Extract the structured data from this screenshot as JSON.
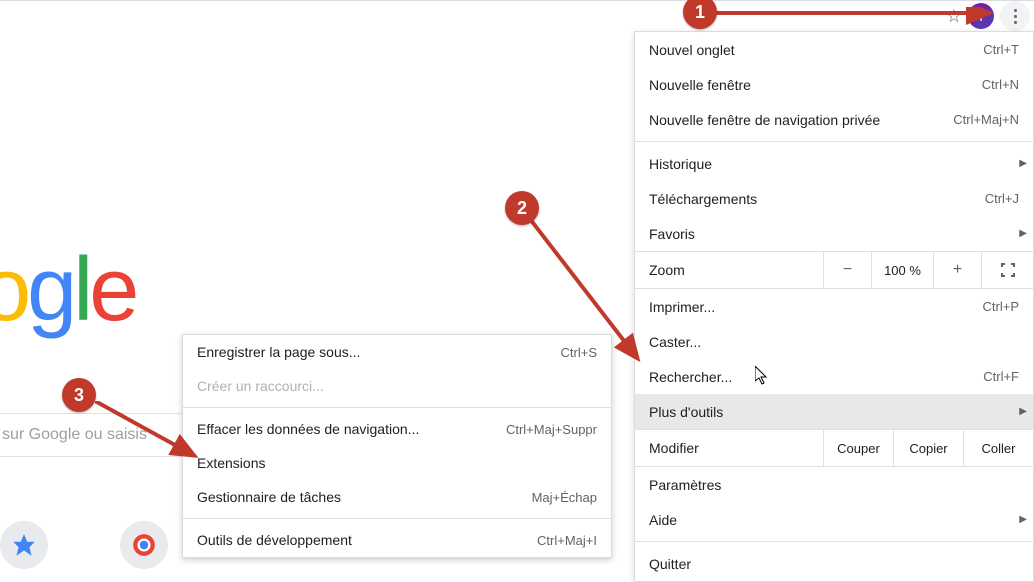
{
  "topbar": {
    "avatar_letter": "I"
  },
  "search_placeholder": "sur Google ou saisis",
  "callouts": {
    "one": "1",
    "two": "2",
    "three": "3"
  },
  "main_menu": {
    "new_tab": {
      "label": "Nouvel onglet",
      "shortcut": "Ctrl+T"
    },
    "new_window": {
      "label": "Nouvelle fenêtre",
      "shortcut": "Ctrl+N"
    },
    "incognito": {
      "label": "Nouvelle fenêtre de navigation privée",
      "shortcut": "Ctrl+Maj+N"
    },
    "history": {
      "label": "Historique"
    },
    "downloads": {
      "label": "Téléchargements",
      "shortcut": "Ctrl+J"
    },
    "bookmarks": {
      "label": "Favoris"
    },
    "zoom": {
      "label": "Zoom",
      "minus": "−",
      "pct": "100 %",
      "plus": "+"
    },
    "print": {
      "label": "Imprimer...",
      "shortcut": "Ctrl+P"
    },
    "cast": {
      "label": "Caster..."
    },
    "find": {
      "label": "Rechercher...",
      "shortcut": "Ctrl+F"
    },
    "more_tools": {
      "label": "Plus d'outils"
    },
    "edit": {
      "label": "Modifier",
      "cut": "Couper",
      "copy": "Copier",
      "paste": "Coller"
    },
    "settings": {
      "label": "Paramètres"
    },
    "help": {
      "label": "Aide"
    },
    "quit": {
      "label": "Quitter"
    }
  },
  "submenu": {
    "save_page": {
      "label": "Enregistrer la page sous...",
      "shortcut": "Ctrl+S"
    },
    "create_shortcut": {
      "label": "Créer un raccourci..."
    },
    "clear_data": {
      "label": "Effacer les données de navigation...",
      "shortcut": "Ctrl+Maj+Suppr"
    },
    "extensions": {
      "label": "Extensions"
    },
    "task_manager": {
      "label": "Gestionnaire de tâches",
      "shortcut": "Maj+Échap"
    },
    "dev_tools": {
      "label": "Outils de développement",
      "shortcut": "Ctrl+Maj+I"
    }
  }
}
